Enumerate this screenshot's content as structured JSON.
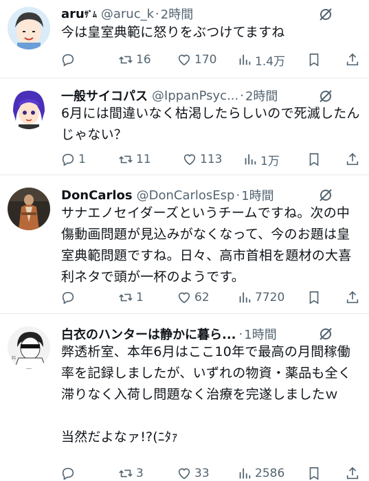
{
  "tweets": [
    {
      "name": "aru☁︎",
      "name_display": "aru",
      "name_suffix": "ｻﾞﾑ",
      "handle": "@aruc_k",
      "time": "2時間",
      "text": "今は皇室典範に怒りをぶつけてますね",
      "replies": "",
      "retweets": "16",
      "likes": "170",
      "views": "1.4万"
    },
    {
      "name_display": "一般サイコパス",
      "handle": "@IppanPsyc...",
      "time": "2時間",
      "text": "6月には間違いなく枯渇したらしいので死滅したんじゃない？",
      "replies": "1",
      "retweets": "11",
      "likes": "113",
      "views": "1万"
    },
    {
      "name_display": "DonCarlos",
      "handle": "@DonCarlosEsp",
      "time": "1時間",
      "text": "サナエノセイダーズというチームですね。次の中傷動画問題が見込みがなくなって、今のお題は皇室典範問題ですね。日々、高市首相を題材の大喜利ネタで頭が一杯のようです。",
      "replies": "",
      "retweets": "1",
      "likes": "62",
      "views": "7720"
    },
    {
      "name_display": "白衣のハンターは静かに暮ら...",
      "handle": "",
      "time": "1時間",
      "text": "弊透析室、本年6月はここ10年で最高の月間稼働率を記録しましたが、いずれの物資・薬品も全く滞りなく入荷し問題なく治療を完遂しましたｗ\n\n当然だよなァ!?(ﾆﾀｧ",
      "replies": "",
      "retweets": "3",
      "likes": "33",
      "views": "2586"
    }
  ],
  "icons": {
    "reply": "reply-icon",
    "retweet": "retweet-icon",
    "like": "like-icon",
    "views": "views-icon",
    "bookmark": "bookmark-icon",
    "share": "share-icon",
    "more": "grok-icon"
  },
  "colors": {
    "text": "#0f1419",
    "muted": "#536471",
    "divider": "#e6e9ec"
  }
}
